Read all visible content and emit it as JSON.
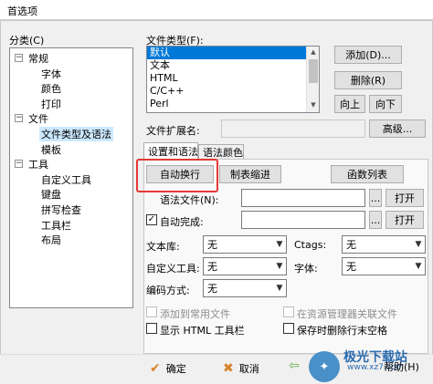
{
  "window": {
    "title": "首选项"
  },
  "category": {
    "label": "分类(C)",
    "tree": [
      {
        "label": "常规",
        "toggle": "−",
        "children": [
          "字体",
          "颜色",
          "打印"
        ]
      },
      {
        "label": "文件",
        "toggle": "−",
        "children": [
          "文件类型及语法",
          "模板"
        ]
      },
      {
        "label": "工具",
        "toggle": "−",
        "children": [
          "自定义工具",
          "键盘",
          "拼写检查",
          "工具栏",
          "布局"
        ]
      }
    ],
    "selected": "文件类型及语法"
  },
  "filetype": {
    "label": "文件类型(F):",
    "items": [
      "默认",
      "文本",
      "HTML",
      "C/C++",
      "Perl"
    ],
    "selected": "默认",
    "buttons": {
      "add": "添加(D)...",
      "delete": "删除(R)",
      "up": "向上",
      "down": "向下"
    },
    "ext_label": "文件扩展名:",
    "ext_value": "",
    "advanced": "高级..."
  },
  "tabs": [
    "设置和语法",
    "语法颜色"
  ],
  "settings": {
    "auto_wrap": "自动换行",
    "tab_indent": "制表缩进",
    "func_list": "函数列表",
    "syntax_file_label": "语法文件(N):",
    "syntax_file_value": "",
    "browse": "...",
    "open": "打开",
    "autocomplete_label": "自动完成:",
    "autocomplete_checked": "✓",
    "autocomplete_value": "",
    "library_label": "文本库:",
    "library_value": "无",
    "ctags_label": "Ctags:",
    "ctags_value": "无",
    "custom_tool_label": "自定义工具:",
    "custom_tool_value": "无",
    "font_label": "字体:",
    "font_value": "无",
    "encoding_label": "编码方式:",
    "encoding_value": "无",
    "add_common": "添加到常用文件",
    "assoc_explorer": "在资源管理器关联文件",
    "show_html_toolbar": "显示 HTML 工具栏",
    "trim_trailing": "保存时删除行末空格"
  },
  "bottom": {
    "ok": "确定",
    "cancel": "取消",
    "help": "帮助(H)",
    "watermark": "极光下载站",
    "watermark_url": "www.xz7.com"
  },
  "colors": {
    "selection": "#0078d7",
    "highlight": "#e53935"
  }
}
